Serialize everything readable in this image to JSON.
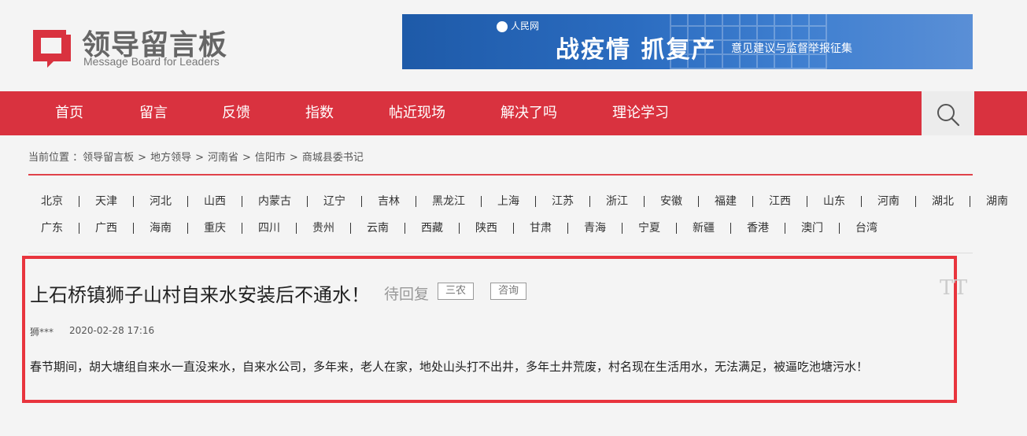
{
  "header": {
    "logo_title": "领导留言板",
    "logo_subtitle": "Message Board for Leaders",
    "banner": {
      "brand": "人民网",
      "brand_domain": "people.cn",
      "headline": "战疫情 抓复产",
      "subline": "意见建议与监督举报征集"
    }
  },
  "nav": {
    "items": [
      "首页",
      "留言",
      "反馈",
      "指数",
      "帖近现场",
      "解决了吗",
      "理论学习"
    ],
    "search_icon": "search-icon"
  },
  "breadcrumb": {
    "prefix": "当前位置 ：",
    "items": [
      "领导留言板",
      "地方领导",
      "河南省",
      "信阳市",
      "商城县委书记"
    ],
    "separator": ">"
  },
  "provinces": {
    "row1": [
      "北京",
      "天津",
      "河北",
      "山西",
      "内蒙古",
      "辽宁",
      "吉林",
      "黑龙江",
      "上海",
      "江苏",
      "浙江",
      "安徽",
      "福建",
      "江西",
      "山东",
      "河南",
      "湖北",
      "湖南"
    ],
    "row2": [
      "广东",
      "广西",
      "海南",
      "重庆",
      "四川",
      "贵州",
      "云南",
      "西藏",
      "陕西",
      "甘肃",
      "青海",
      "宁夏",
      "新疆",
      "香港",
      "澳门",
      "台湾"
    ]
  },
  "message": {
    "title": "上石桥镇狮子山村自来水安装后不通水！",
    "status": "待回复",
    "tags": [
      "三农",
      "咨询"
    ],
    "font_toggle": "TT",
    "author": "狮***",
    "time": "2020-02-28 17:16",
    "body": "春节期间，胡大塘组自来水一直没来水，自来水公司，多年来，老人在家，地处山头打不出井，多年土井荒废，村名现在生活用水，无法满足，被逼吃池塘污水！"
  },
  "colors": {
    "brand_red": "#d9323f",
    "card_border": "#e8343d",
    "banner_blue": "#1e5aa8"
  }
}
